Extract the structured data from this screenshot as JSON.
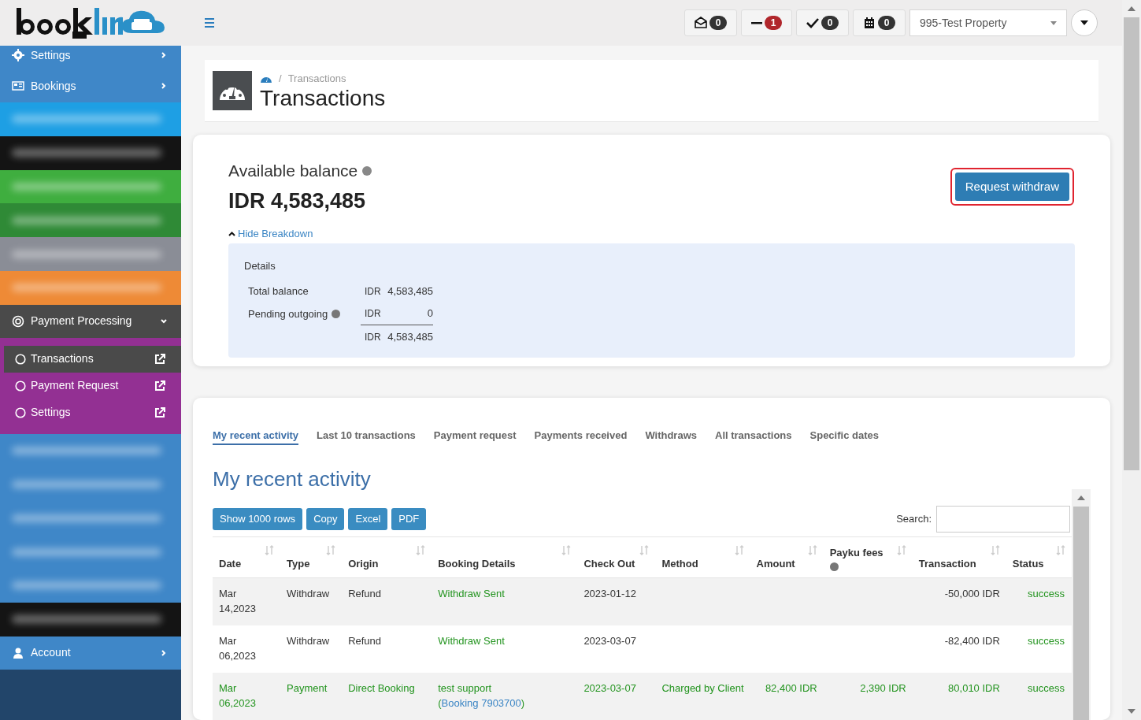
{
  "topbar": {
    "counters": [
      {
        "kind": "envelope",
        "count": "0",
        "color": "#333333"
      },
      {
        "kind": "minus",
        "count": "1",
        "color": "#b0262b"
      },
      {
        "kind": "check",
        "count": "0",
        "color": "#333333"
      },
      {
        "kind": "calendar",
        "count": "0",
        "color": "#333333"
      }
    ],
    "property_select": {
      "value": "995-Test Property"
    }
  },
  "sidebar": {
    "items": [
      {
        "kind": "link",
        "label": "Settings"
      },
      {
        "kind": "link",
        "label": "Bookings"
      },
      {
        "kind": "blurred",
        "color": "#1e9fe4"
      },
      {
        "kind": "blurred",
        "color": "#141414"
      },
      {
        "kind": "blurred",
        "color": "#3fae3f"
      },
      {
        "kind": "blurred",
        "color": "#2f8a36"
      },
      {
        "kind": "blurred",
        "color": "#8a8d96"
      },
      {
        "kind": "blurred",
        "color": "#ee8a36"
      },
      {
        "kind": "group",
        "label": "Payment Processing",
        "expanded": true,
        "children": [
          {
            "label": "Transactions",
            "selected": true
          },
          {
            "label": "Payment Request",
            "selected": false
          },
          {
            "label": "Settings",
            "selected": false
          }
        ]
      },
      {
        "kind": "blurred",
        "color": "#3f87c8"
      },
      {
        "kind": "blurred",
        "color": "#3f87c8"
      },
      {
        "kind": "blurred",
        "color": "#3f87c8"
      },
      {
        "kind": "blurred",
        "color": "#3f87c8"
      },
      {
        "kind": "blurred",
        "color": "#3f87c8"
      },
      {
        "kind": "blurred",
        "color": "#141414"
      },
      {
        "kind": "link",
        "label": "Account"
      }
    ]
  },
  "breadcrumb": {
    "separator": "/",
    "items": [
      "Transactions"
    ]
  },
  "page_title": "Transactions",
  "balance": {
    "label": "Available balance",
    "amount": "IDR 4,583,485",
    "request_button": "Request withdraw",
    "toggle": "Hide Breakdown",
    "expanded": true,
    "details_title": "Details",
    "rows": [
      {
        "label": "Total balance",
        "currency": "IDR",
        "value": "4,583,485",
        "help": false
      },
      {
        "label": "Pending outgoing",
        "currency": "IDR",
        "value": "0",
        "help": true
      }
    ],
    "total": {
      "currency": "IDR",
      "value": "4,583,485"
    }
  },
  "tabs": [
    {
      "label": "My recent activity",
      "selected": true
    },
    {
      "label": "Last 10 transactions",
      "selected": false
    },
    {
      "label": "Payment request",
      "selected": false
    },
    {
      "label": "Payments received",
      "selected": false
    },
    {
      "label": "Withdraws",
      "selected": false
    },
    {
      "label": "All transactions",
      "selected": false
    },
    {
      "label": "Specific dates",
      "selected": false
    }
  ],
  "section_title": "My recent activity",
  "export_buttons": [
    "Show 1000 rows",
    "Copy",
    "Excel",
    "PDF"
  ],
  "search": {
    "label": "Search:"
  },
  "table": {
    "columns": [
      {
        "label": "Date",
        "help": false
      },
      {
        "label": "Type",
        "help": false
      },
      {
        "label": "Origin",
        "help": false
      },
      {
        "label": "Booking Details",
        "help": false
      },
      {
        "label": "Check Out",
        "help": false
      },
      {
        "label": "Method",
        "help": false
      },
      {
        "label": "Amount",
        "help": false
      },
      {
        "label": "Payku fees",
        "help": true
      },
      {
        "label": "Transaction",
        "help": false
      },
      {
        "label": "Status",
        "help": false
      }
    ],
    "rows": [
      {
        "kind": "withdraw",
        "date": "Mar 14,2023",
        "type": "Withdraw",
        "origin": "Refund",
        "booking": {
          "before": "Withdraw Sent"
        },
        "check_out": "2023-01-12",
        "transaction": "-50,000 IDR",
        "status": "success"
      },
      {
        "kind": "withdraw",
        "date": "Mar 06,2023",
        "type": "Withdraw",
        "origin": "Refund",
        "booking": {
          "before": "Withdraw Sent"
        },
        "check_out": "2023-03-07",
        "transaction": "-82,400 IDR",
        "status": "success"
      },
      {
        "kind": "payment",
        "date": "Mar 06,2023",
        "type": "Payment",
        "origin": "Direct Booking",
        "booking": {
          "before": "test support (",
          "link": "Booking 7903700",
          "after": ")"
        },
        "check_out": "2023-03-07",
        "method": "Charged by Client",
        "amount": "82,400 IDR",
        "fees": "2,390 IDR",
        "transaction": "80,010 IDR",
        "status": "success"
      }
    ]
  }
}
